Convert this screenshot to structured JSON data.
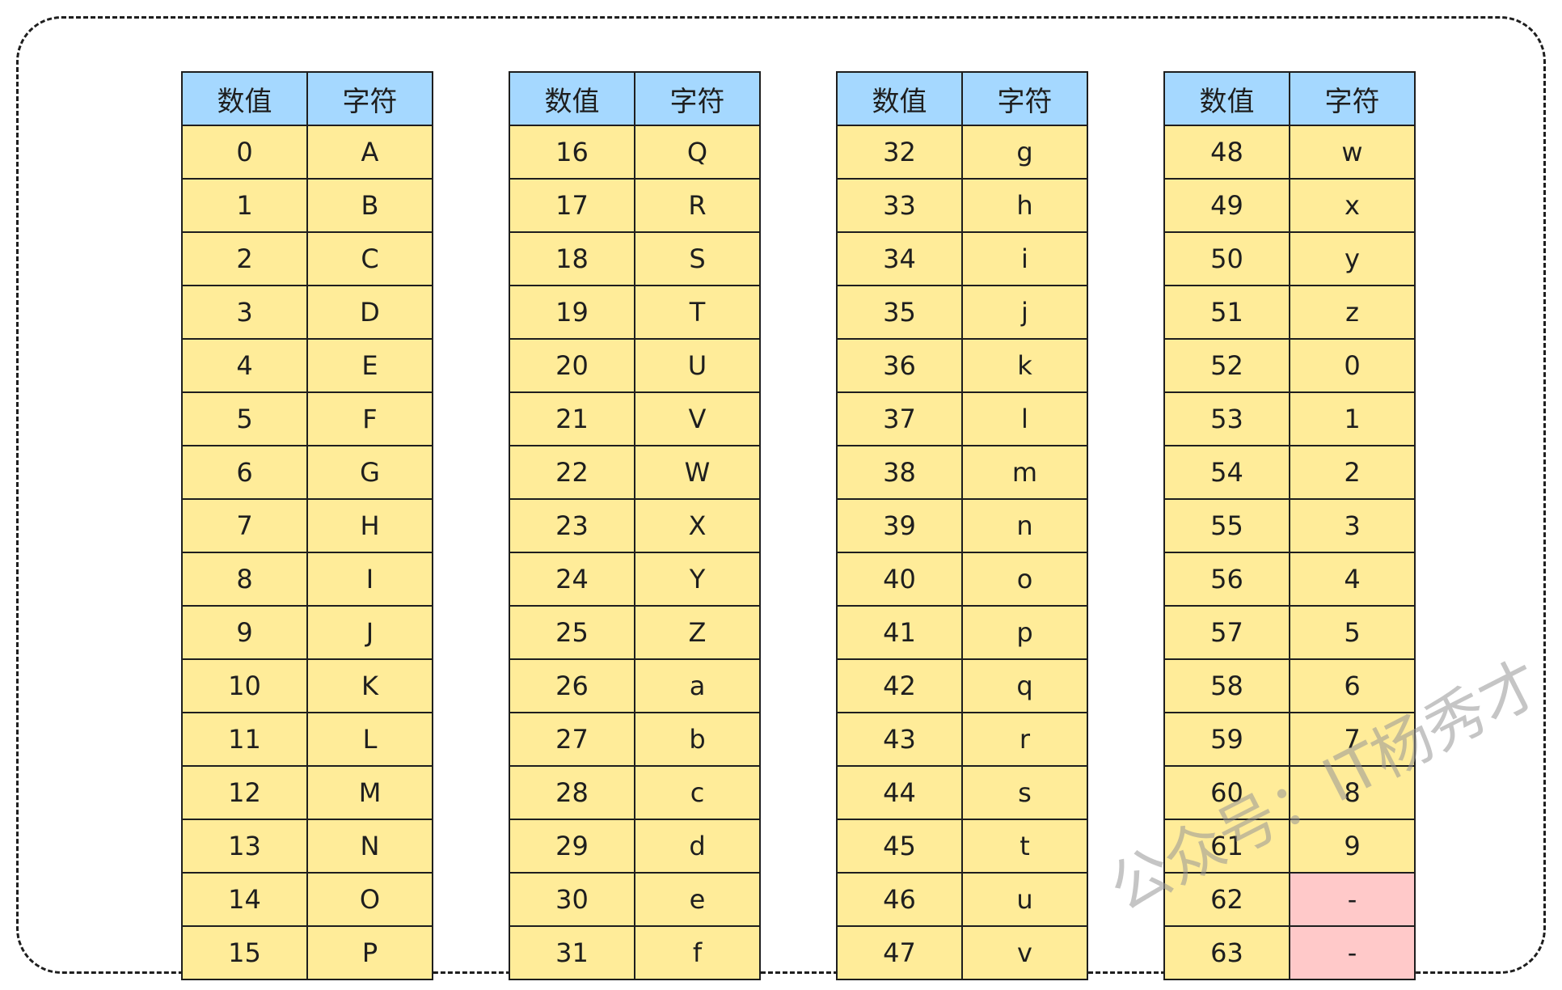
{
  "header": {
    "value_label": "数值",
    "char_label": "字符"
  },
  "tables": [
    {
      "rows": [
        {
          "value": "0",
          "char": "A"
        },
        {
          "value": "1",
          "char": "B"
        },
        {
          "value": "2",
          "char": "C"
        },
        {
          "value": "3",
          "char": "D"
        },
        {
          "value": "4",
          "char": "E"
        },
        {
          "value": "5",
          "char": "F"
        },
        {
          "value": "6",
          "char": "G"
        },
        {
          "value": "7",
          "char": "H"
        },
        {
          "value": "8",
          "char": "I"
        },
        {
          "value": "9",
          "char": "J"
        },
        {
          "value": "10",
          "char": "K"
        },
        {
          "value": "11",
          "char": "L"
        },
        {
          "value": "12",
          "char": "M"
        },
        {
          "value": "13",
          "char": "N"
        },
        {
          "value": "14",
          "char": "O"
        },
        {
          "value": "15",
          "char": "P"
        }
      ]
    },
    {
      "rows": [
        {
          "value": "16",
          "char": "Q"
        },
        {
          "value": "17",
          "char": "R"
        },
        {
          "value": "18",
          "char": "S"
        },
        {
          "value": "19",
          "char": "T"
        },
        {
          "value": "20",
          "char": "U"
        },
        {
          "value": "21",
          "char": "V"
        },
        {
          "value": "22",
          "char": "W"
        },
        {
          "value": "23",
          "char": "X"
        },
        {
          "value": "24",
          "char": "Y"
        },
        {
          "value": "25",
          "char": "Z"
        },
        {
          "value": "26",
          "char": "a"
        },
        {
          "value": "27",
          "char": "b"
        },
        {
          "value": "28",
          "char": "c"
        },
        {
          "value": "29",
          "char": "d"
        },
        {
          "value": "30",
          "char": "e"
        },
        {
          "value": "31",
          "char": "f"
        }
      ]
    },
    {
      "rows": [
        {
          "value": "32",
          "char": "g"
        },
        {
          "value": "33",
          "char": "h"
        },
        {
          "value": "34",
          "char": "i"
        },
        {
          "value": "35",
          "char": "j"
        },
        {
          "value": "36",
          "char": "k"
        },
        {
          "value": "37",
          "char": "l"
        },
        {
          "value": "38",
          "char": "m"
        },
        {
          "value": "39",
          "char": "n"
        },
        {
          "value": "40",
          "char": "o"
        },
        {
          "value": "41",
          "char": "p"
        },
        {
          "value": "42",
          "char": "q"
        },
        {
          "value": "43",
          "char": "r"
        },
        {
          "value": "44",
          "char": "s"
        },
        {
          "value": "45",
          "char": "t"
        },
        {
          "value": "46",
          "char": "u"
        },
        {
          "value": "47",
          "char": "v"
        }
      ]
    },
    {
      "rows": [
        {
          "value": "48",
          "char": "w"
        },
        {
          "value": "49",
          "char": "x"
        },
        {
          "value": "50",
          "char": "y"
        },
        {
          "value": "51",
          "char": "z"
        },
        {
          "value": "52",
          "char": "0"
        },
        {
          "value": "53",
          "char": "1"
        },
        {
          "value": "54",
          "char": "2"
        },
        {
          "value": "55",
          "char": "3"
        },
        {
          "value": "56",
          "char": "4"
        },
        {
          "value": "57",
          "char": "5"
        },
        {
          "value": "58",
          "char": "6"
        },
        {
          "value": "59",
          "char": "7"
        },
        {
          "value": "60",
          "char": "8"
        },
        {
          "value": "61",
          "char": "9"
        },
        {
          "value": "62",
          "char": "-",
          "highlight": true
        },
        {
          "value": "63",
          "char": "-",
          "highlight": true
        }
      ]
    }
  ],
  "colors": {
    "header_bg": "#a5d8ff",
    "cell_bg": "#ffec99",
    "highlight_bg": "#ffc9c9",
    "border": "#1e1e1e"
  },
  "watermark": "公众号：IT杨秀才"
}
